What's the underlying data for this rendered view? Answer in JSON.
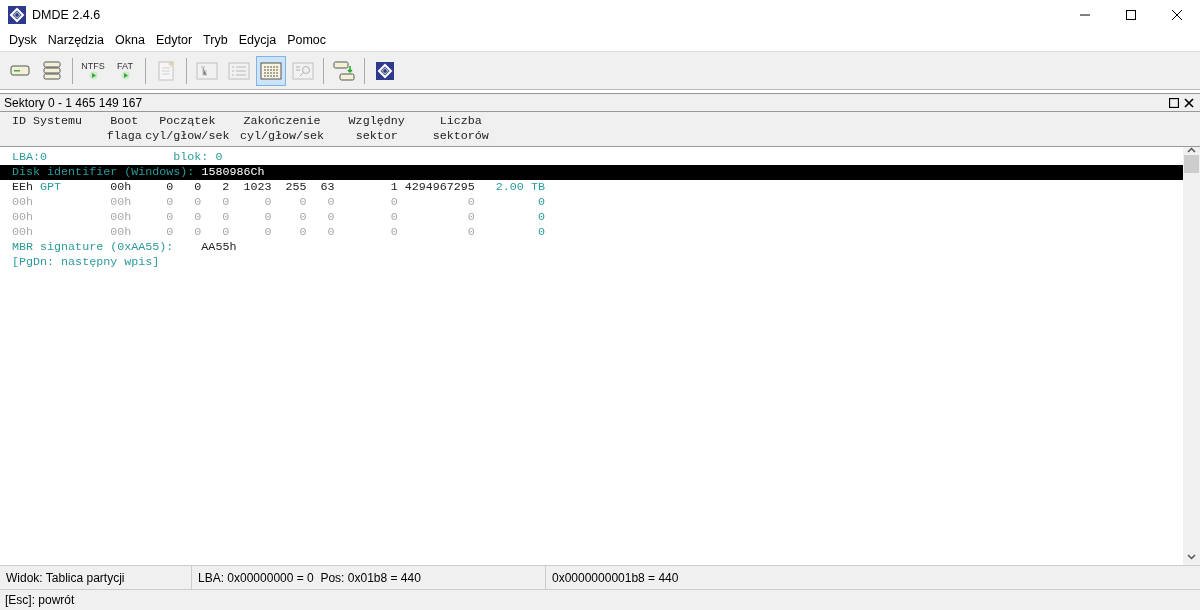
{
  "window": {
    "title": "DMDE 2.4.6"
  },
  "menu": [
    "Dysk",
    "Narzędzia",
    "Okna",
    "Edytor",
    "Tryb",
    "Edycja",
    "Pomoc"
  ],
  "toolbar": [
    [
      {
        "kind": "drive",
        "disabled": false,
        "selected": false
      },
      {
        "kind": "drives",
        "disabled": false,
        "selected": false
      }
    ],
    [
      {
        "kind": "fs",
        "label": "NTFS",
        "disabled": false,
        "selected": false
      },
      {
        "kind": "fs",
        "label": "FAT",
        "disabled": false,
        "selected": false
      }
    ],
    [
      {
        "kind": "newfile",
        "disabled": true,
        "selected": false
      }
    ],
    [
      {
        "kind": "tree",
        "disabled": true,
        "selected": false
      },
      {
        "kind": "list",
        "disabled": true,
        "selected": false
      },
      {
        "kind": "table",
        "disabled": false,
        "selected": true
      },
      {
        "kind": "find",
        "disabled": true,
        "selected": false
      }
    ],
    [
      {
        "kind": "copy",
        "disabled": false,
        "selected": false
      }
    ],
    [
      {
        "kind": "logo",
        "disabled": false,
        "selected": false
      }
    ]
  ],
  "panel": {
    "title": "Sektory 0 - 1 465 149 167",
    "header": [
      {
        "line1": "ID Systemu"
      },
      {
        "line1": "Boot",
        "line2": "flaga"
      },
      {
        "line1": "Początek",
        "line2": "cyl/głow/sek"
      },
      {
        "line1": "Zakończenie",
        "line2": "cyl/głow/sek"
      },
      {
        "line1": "Względny",
        "line2": "sektor"
      },
      {
        "line1": "Liczba",
        "line2": "sektorów"
      }
    ],
    "lba_line": {
      "lba": "LBA:0",
      "block": "blok: 0"
    },
    "disk_id": {
      "label": "Disk identifier (Windows):",
      "value": "1580986Ch",
      "selected": true
    },
    "partitions": [
      {
        "id": "EEh",
        "type": "GPT",
        "boot": "00h",
        "start": [
          "0",
          "0",
          "2"
        ],
        "end": [
          "1023",
          "255",
          "63"
        ],
        "relative": "1",
        "count": "4294967295",
        "size": "2.00 TB",
        "empty": false
      },
      {
        "id": "00h",
        "boot": "00h",
        "start": [
          "0",
          "0",
          "0"
        ],
        "end": [
          "0",
          "0",
          "0"
        ],
        "relative": "0",
        "count": "0",
        "size": "0",
        "empty": true
      },
      {
        "id": "00h",
        "boot": "00h",
        "start": [
          "0",
          "0",
          "0"
        ],
        "end": [
          "0",
          "0",
          "0"
        ],
        "relative": "0",
        "count": "0",
        "size": "0",
        "empty": true
      },
      {
        "id": "00h",
        "boot": "00h",
        "start": [
          "0",
          "0",
          "0"
        ],
        "end": [
          "0",
          "0",
          "0"
        ],
        "relative": "0",
        "count": "0",
        "size": "0",
        "empty": true
      }
    ],
    "signature": {
      "label": "MBR signature (0xAA55):",
      "value": "AA55h"
    },
    "hint": "[PgDn: następny wpis]"
  },
  "status_bar": [
    "Widok: Tablica partycji",
    "LBA: 0x00000000 = 0  Pos: 0x01b8 = 440",
    "0x0000000001b8 = 440"
  ],
  "bottom_hint": "[Esc]: powrót"
}
